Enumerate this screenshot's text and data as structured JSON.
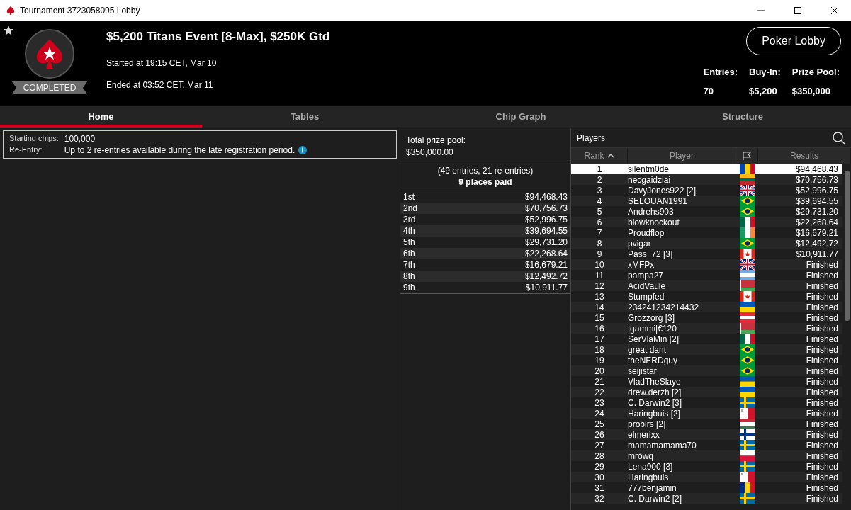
{
  "window": {
    "title": "Tournament 3723058095 Lobby"
  },
  "header": {
    "favorite": true,
    "status": "COMPLETED",
    "event_title": "$5,200 Titans Event [8-Max], $250K Gtd",
    "started": "Started at 19:15 CET, Mar 10",
    "ended": "Ended at 03:52 CET, Mar 11",
    "lobby_button": "Poker Lobby",
    "stats": [
      {
        "label": "Entries:",
        "value": "70"
      },
      {
        "label": "Buy-In:",
        "value": "$5,200"
      },
      {
        "label": "Prize Pool:",
        "value": "$350,000"
      }
    ]
  },
  "tabs": [
    {
      "label": "Home",
      "selected": true
    },
    {
      "label": "Tables",
      "selected": false
    },
    {
      "label": "Chip Graph",
      "selected": false
    },
    {
      "label": "Structure",
      "selected": false
    }
  ],
  "info": [
    {
      "label": "Starting chips:",
      "value": "100,000"
    },
    {
      "label": "Re-Entry:",
      "value": "Up to 2 re-entries available during the late registration period.",
      "info_icon": true
    }
  ],
  "prizes": {
    "total_label": "Total prize pool:",
    "total": "$350,000.00",
    "entries_note": "(49 entries, 21 re-entries)",
    "places_paid": "9 places paid",
    "rows": [
      {
        "place": "1st",
        "amount": "$94,468.43"
      },
      {
        "place": "2nd",
        "amount": "$70,756.73"
      },
      {
        "place": "3rd",
        "amount": "$52,996.75"
      },
      {
        "place": "4th",
        "amount": "$39,694.55"
      },
      {
        "place": "5th",
        "amount": "$29,731.20"
      },
      {
        "place": "6th",
        "amount": "$22,268.64"
      },
      {
        "place": "7th",
        "amount": "$16,679.21"
      },
      {
        "place": "8th",
        "amount": "$12,492.72"
      },
      {
        "place": "9th",
        "amount": "$10,911.77"
      }
    ]
  },
  "players": {
    "title": "Players",
    "columns": [
      "Rank",
      "Player",
      "Results"
    ],
    "rows": [
      {
        "rank": "1",
        "player": "silentm0de",
        "flag": {
          "kind": "md"
        },
        "result": "$94,468.43",
        "selected": true
      },
      {
        "rank": "2",
        "player": "necgaidziai",
        "flag": {
          "kind": "lt"
        },
        "result": "$70,756.73",
        "selected": false
      },
      {
        "rank": "3",
        "player": "DavyJones922 [2]",
        "flag": {
          "kind": "gb"
        },
        "result": "$52,996.75",
        "selected": false
      },
      {
        "rank": "4",
        "player": "SELOUAN1991",
        "flag": {
          "kind": "br"
        },
        "result": "$39,694.55",
        "selected": false
      },
      {
        "rank": "5",
        "player": "Andrehs903",
        "flag": {
          "kind": "br"
        },
        "result": "$29,731.20",
        "selected": false
      },
      {
        "rank": "6",
        "player": "blowknockout",
        "flag": {
          "kind": "mx"
        },
        "result": "$22,268.64",
        "selected": false
      },
      {
        "rank": "7",
        "player": "Proudflop",
        "flag": {
          "kind": "ie"
        },
        "result": "$16,679.21",
        "selected": false
      },
      {
        "rank": "8",
        "player": "pvigar",
        "flag": {
          "kind": "br"
        },
        "result": "$12,492.72",
        "selected": false
      },
      {
        "rank": "9",
        "player": "Pass_72 [3]",
        "flag": {
          "kind": "ca"
        },
        "result": "$10,911.77",
        "selected": false
      },
      {
        "rank": "10",
        "player": "xMFPx",
        "flag": {
          "kind": "gb"
        },
        "result": "Finished",
        "selected": false
      },
      {
        "rank": "11",
        "player": "pampa27",
        "flag": {
          "kind": "ar"
        },
        "result": "Finished",
        "selected": false
      },
      {
        "rank": "12",
        "player": "AcidVaule",
        "flag": {
          "kind": "by"
        },
        "result": "Finished",
        "selected": false
      },
      {
        "rank": "13",
        "player": "Stumpfed",
        "flag": {
          "kind": "ca"
        },
        "result": "Finished",
        "selected": false
      },
      {
        "rank": "14",
        "player": "234241234214432",
        "flag": {
          "kind": "ua"
        },
        "result": "Finished",
        "selected": false
      },
      {
        "rank": "15",
        "player": "Grozzorg [3]",
        "flag": {
          "kind": "at"
        },
        "result": "Finished",
        "selected": false
      },
      {
        "rank": "16",
        "player": "|gammi|€120",
        "flag": {
          "kind": "by"
        },
        "result": "Finished",
        "selected": false
      },
      {
        "rank": "17",
        "player": "SerVlaMin [2]",
        "flag": {
          "kind": "mx"
        },
        "result": "Finished",
        "selected": false
      },
      {
        "rank": "18",
        "player": "great dant",
        "flag": {
          "kind": "br"
        },
        "result": "Finished",
        "selected": false
      },
      {
        "rank": "19",
        "player": "theNERDguy",
        "flag": {
          "kind": "br"
        },
        "result": "Finished",
        "selected": false
      },
      {
        "rank": "20",
        "player": "seijistar",
        "flag": {
          "kind": "br"
        },
        "result": "Finished",
        "selected": false
      },
      {
        "rank": "21",
        "player": "VladTheSlaye",
        "flag": {
          "kind": "ua"
        },
        "result": "Finished",
        "selected": false
      },
      {
        "rank": "22",
        "player": "drew.derzh [2]",
        "flag": {
          "kind": "ua"
        },
        "result": "Finished",
        "selected": false
      },
      {
        "rank": "23",
        "player": "C. Darwin2 [3]",
        "flag": {
          "kind": "se"
        },
        "result": "Finished",
        "selected": false
      },
      {
        "rank": "24",
        "player": "Haringbuis [2]",
        "flag": {
          "kind": "mt"
        },
        "result": "Finished",
        "selected": false
      },
      {
        "rank": "25",
        "player": "probirs [2]",
        "flag": {
          "kind": "hu"
        },
        "result": "Finished",
        "selected": false
      },
      {
        "rank": "26",
        "player": "elmerixx",
        "flag": {
          "kind": "fi"
        },
        "result": "Finished",
        "selected": false
      },
      {
        "rank": "27",
        "player": "mamamamama70",
        "flag": {
          "kind": "se"
        },
        "result": "Finished",
        "selected": false
      },
      {
        "rank": "28",
        "player": "mrówq",
        "flag": {
          "kind": "pl"
        },
        "result": "Finished",
        "selected": false
      },
      {
        "rank": "29",
        "player": "Lena900 [3]",
        "flag": {
          "kind": "se"
        },
        "result": "Finished",
        "selected": false
      },
      {
        "rank": "30",
        "player": "Haringbuis",
        "flag": {
          "kind": "mt"
        },
        "result": "Finished",
        "selected": false
      },
      {
        "rank": "31",
        "player": "777benjamin",
        "flag": {
          "kind": "ro"
        },
        "result": "Finished",
        "selected": false
      },
      {
        "rank": "32",
        "player": "C. Darwin2 [2]",
        "flag": {
          "kind": "se"
        },
        "result": "Finished",
        "selected": false
      }
    ]
  }
}
